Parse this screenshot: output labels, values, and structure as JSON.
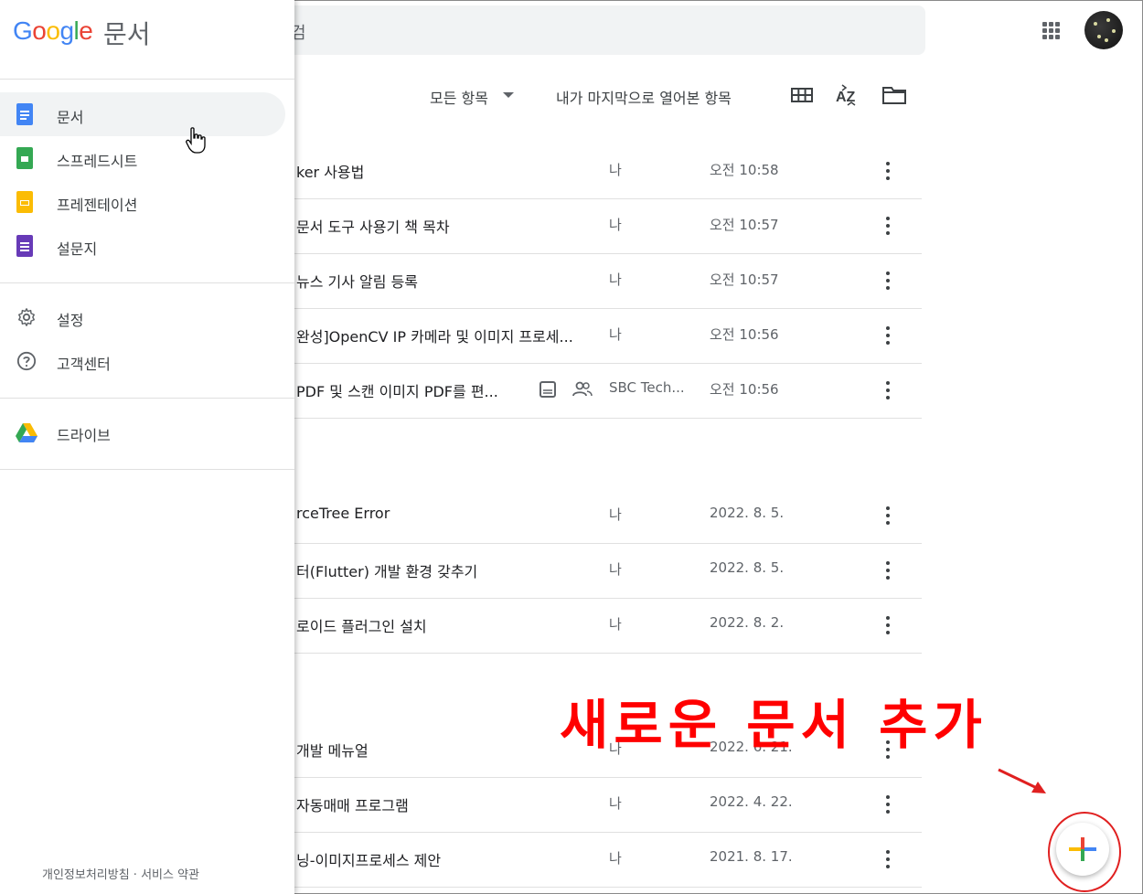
{
  "app": {
    "logo_parts": [
      "G",
      "o",
      "o",
      "g",
      "l",
      "e"
    ],
    "product": "문서"
  },
  "search": {
    "hint": "검"
  },
  "toolbar": {
    "owner_filter": "모든 항목",
    "sort_label": "내가 마지막으로 열어본 항목"
  },
  "drawer": {
    "items": [
      {
        "label": "문서",
        "icon": "docs-icon",
        "color": "#4285f4"
      },
      {
        "label": "스프레드시트",
        "icon": "sheets-icon",
        "color": "#34a853"
      },
      {
        "label": "프레젠테이션",
        "icon": "slides-icon",
        "color": "#fbbc04"
      },
      {
        "label": "설문지",
        "icon": "forms-icon",
        "color": "#673ab7"
      }
    ],
    "settings": "설정",
    "help": "고객센터",
    "drive": "드라이브",
    "footer": "개인정보처리방침 · 서비스 약관"
  },
  "files": [
    {
      "title": "ker 사용법",
      "owner": "나",
      "date": "오전 10:58"
    },
    {
      "title": "문서 도구 사용기 책 목차",
      "owner": "나",
      "date": "오전 10:57"
    },
    {
      "title": "뉴스 기사 알림 등록",
      "owner": "나",
      "date": "오전 10:57"
    },
    {
      "title": "완성]OpenCV IP 카메라 및 이미지 프로세...",
      "owner": "나",
      "date": "오전 10:56"
    },
    {
      "title": "PDF 및 스캔 이미지 PDF를 편...",
      "owner": "SBC Tech...",
      "date": "오전 10:56"
    },
    {
      "title": "rceTree Error",
      "owner": "나",
      "date": "2022. 8. 5."
    },
    {
      "title": "터(Flutter) 개발 환경 갖추기",
      "owner": "나",
      "date": "2022. 8. 5."
    },
    {
      "title": "로이드 플러그인 설치",
      "owner": "나",
      "date": "2022. 8. 2."
    },
    {
      "title": "개발 메뉴얼",
      "owner": "나",
      "date": "2022. 6. 21."
    },
    {
      "title": "자동매매 프로그램",
      "owner": "나",
      "date": "2022. 4. 22."
    },
    {
      "title": "닝-이미지프로세스 제안",
      "owner": "나",
      "date": "2021. 8. 17."
    }
  ],
  "annotation": {
    "text": "새로운 문서 추가",
    "color": "#ff0000"
  }
}
